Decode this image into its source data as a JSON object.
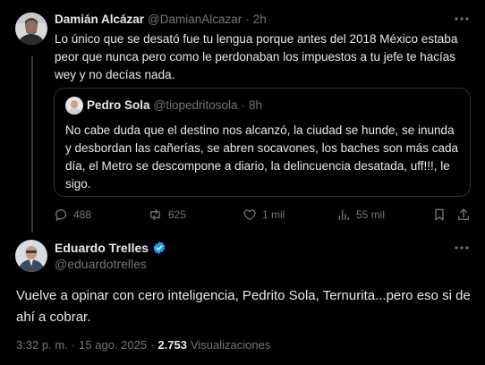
{
  "tweet1": {
    "author_name": "Damián Alcázar",
    "author_handle": "@DamianAlcazar",
    "separator": "·",
    "time": "2h",
    "text": "Lo único que se desató fue tu lengua porque antes del 2018 México estaba peor que nunca pero como le perdonaban los impuestos a tu jefe te hacías wey y no decías nada.",
    "quoted": {
      "author_name": "Pedro Sola",
      "author_handle": "@tiopedritosola",
      "separator": "·",
      "time": "8h",
      "text": "No cabe duda que el destino nos alcanzó, la ciudad se hunde, se inunda y desbordan las cañerías, se abren socavones, los baches son más cada día, el Metro se descompone a diario, la delincuencia desatada, uff!!!, le sigo."
    },
    "actions": {
      "replies": "488",
      "reposts": "625",
      "likes": "1 mil",
      "views": "55 mil"
    }
  },
  "tweet2": {
    "author_name": "Eduardo Trelles",
    "author_handle": "@eduardotrelles",
    "text": "Vuelve a opinar con cero inteligencia, Pedrito Sola, Ternurita...pero eso si de ahí a cobrar.",
    "time": "3:32 p. m.",
    "separator": "·",
    "date": "15 ago. 2025",
    "separator2": "·",
    "views_count": "2.753",
    "views_label": "Visualizaciones"
  },
  "colors": {
    "background": "#000000",
    "text": "#e7e9ea",
    "muted": "#71767b",
    "border": "#2f3336",
    "verified": "#1d9bf0"
  },
  "icons": {
    "more": "more-dots-icon",
    "reply": "reply-bubble-icon",
    "repost": "repost-arrows-icon",
    "like": "heart-icon",
    "views": "bar-chart-icon",
    "bookmark": "bookmark-icon",
    "share": "share-upload-icon",
    "verified": "verified-badge-icon"
  }
}
